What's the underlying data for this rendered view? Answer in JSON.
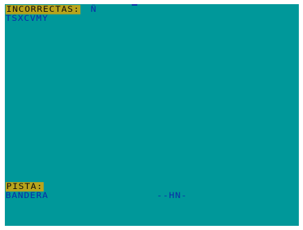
{
  "colors": {
    "screen_bg": "#00989a",
    "ink": "#0b2ca8",
    "label_bg": "#b8a41c",
    "label_fg": "#111111"
  },
  "wrong_guesses": {
    "label": "INCORRECTAS:",
    "marker": "Ñ",
    "letters": "TSXCVMY"
  },
  "hint": {
    "label": "PISTA:",
    "value": "BANDERA"
  },
  "word": {
    "pattern": "--HN-"
  }
}
